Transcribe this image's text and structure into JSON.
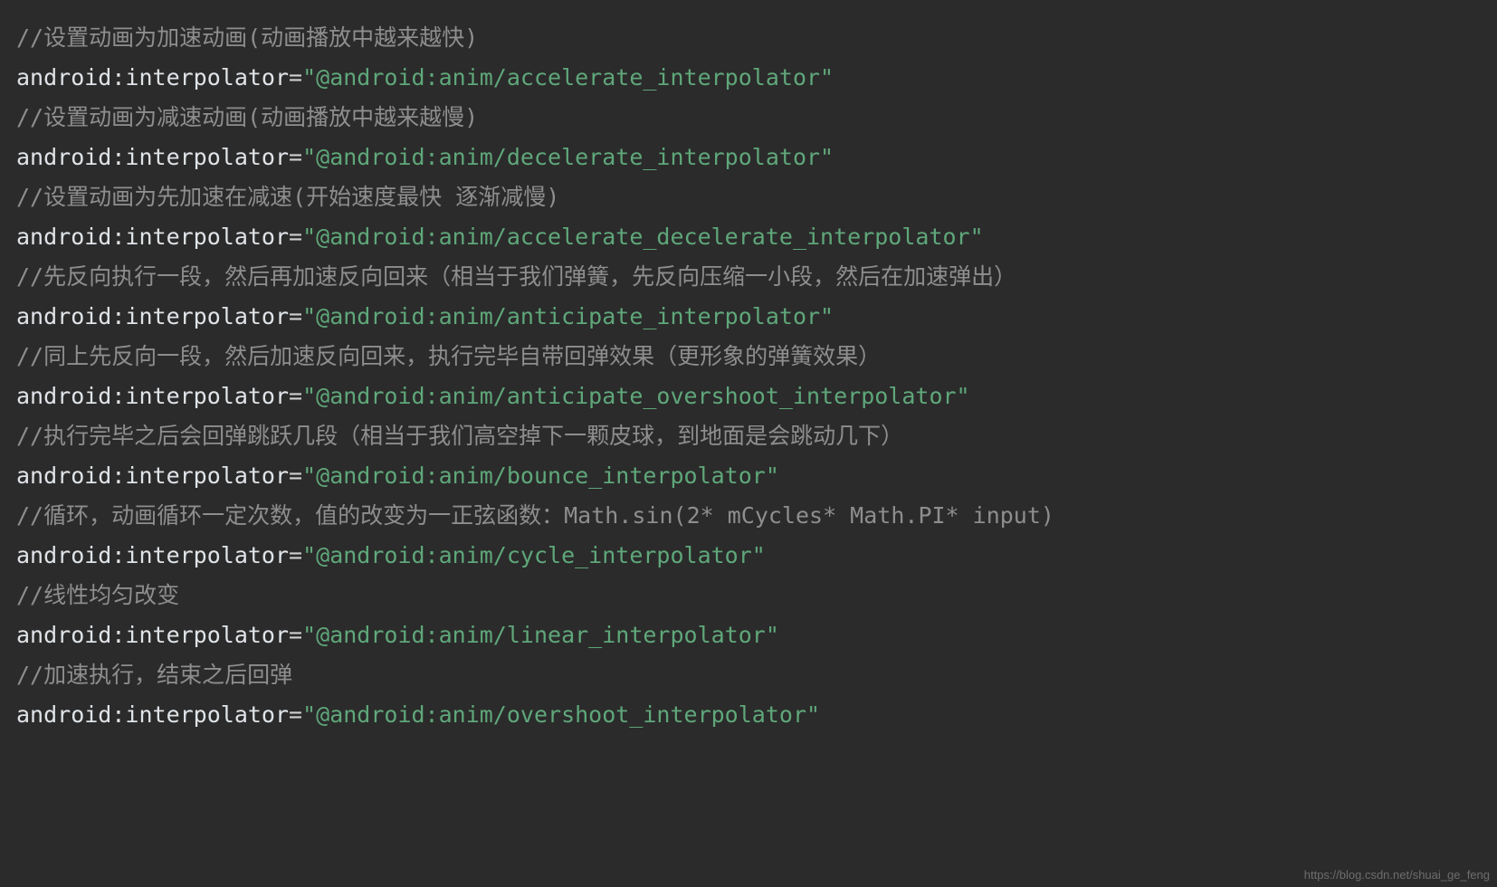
{
  "lines": [
    {
      "type": "comment",
      "text": "//设置动画为加速动画(动画播放中越来越快)"
    },
    {
      "type": "code",
      "attr": "android:interpolator",
      "value": "\"@android:anim/accelerate_interpolator\""
    },
    {
      "type": "comment",
      "text": "//设置动画为减速动画(动画播放中越来越慢)"
    },
    {
      "type": "code",
      "attr": "android:interpolator",
      "value": "\"@android:anim/decelerate_interpolator\""
    },
    {
      "type": "comment",
      "text": "//设置动画为先加速在减速(开始速度最快 逐渐减慢)"
    },
    {
      "type": "code",
      "attr": "android:interpolator",
      "value": "\"@android:anim/accelerate_decelerate_interpolator\""
    },
    {
      "type": "comment",
      "text": "//先反向执行一段，然后再加速反向回来（相当于我们弹簧，先反向压缩一小段，然后在加速弹出）"
    },
    {
      "type": "code",
      "attr": "android:interpolator",
      "value": "\"@android:anim/anticipate_interpolator\""
    },
    {
      "type": "comment",
      "text": "//同上先反向一段，然后加速反向回来，执行完毕自带回弹效果（更形象的弹簧效果）"
    },
    {
      "type": "code",
      "attr": "android:interpolator",
      "value": "\"@android:anim/anticipate_overshoot_interpolator\""
    },
    {
      "type": "comment",
      "text": "//执行完毕之后会回弹跳跃几段（相当于我们高空掉下一颗皮球，到地面是会跳动几下）"
    },
    {
      "type": "code",
      "attr": "android:interpolator",
      "value": "\"@android:anim/bounce_interpolator\""
    },
    {
      "type": "comment",
      "text": "//循环，动画循环一定次数，值的改变为一正弦函数：Math.sin(2* mCycles* Math.PI* input)"
    },
    {
      "type": "code",
      "attr": "android:interpolator",
      "value": "\"@android:anim/cycle_interpolator\""
    },
    {
      "type": "comment",
      "text": "//线性均匀改变"
    },
    {
      "type": "code",
      "attr": "android:interpolator",
      "value": "\"@android:anim/linear_interpolator\""
    },
    {
      "type": "comment",
      "text": "//加速执行，结束之后回弹"
    },
    {
      "type": "code",
      "attr": "android:interpolator",
      "value": "\"@android:anim/overshoot_interpolator\""
    }
  ],
  "watermark": "https://blog.csdn.net/shuai_ge_feng"
}
